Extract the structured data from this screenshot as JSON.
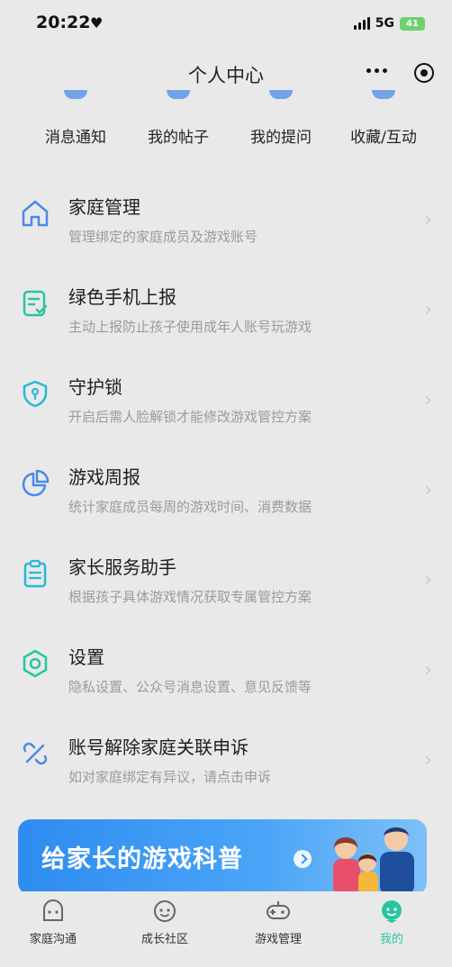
{
  "status": {
    "time": "20:22",
    "network": "5G",
    "battery": "41"
  },
  "header": {
    "title": "个人中心"
  },
  "quick_links": [
    {
      "label": "消息通知"
    },
    {
      "label": "我的帖子"
    },
    {
      "label": "我的提问"
    },
    {
      "label": "收藏/互动"
    }
  ],
  "menu": [
    {
      "title": "家庭管理",
      "desc": "管理绑定的家庭成员及游戏账号",
      "icon": "home-icon"
    },
    {
      "title": "绿色手机上报",
      "desc": "主动上报防止孩子使用成年人账号玩游戏",
      "icon": "report-doc-icon"
    },
    {
      "title": "守护锁",
      "desc": "开启后需人脸解锁才能修改游戏管控方案",
      "icon": "shield-lock-icon"
    },
    {
      "title": "游戏周报",
      "desc": "统计家庭成员每周的游戏时间、消费数据",
      "icon": "pie-chart-icon"
    },
    {
      "title": "家长服务助手",
      "desc": "根据孩子具体游戏情况获取专属管控方案",
      "icon": "clipboard-icon"
    },
    {
      "title": "设置",
      "desc": "隐私设置、公众号消息设置、意见反馈等",
      "icon": "settings-hexagon-icon"
    },
    {
      "title": "账号解除家庭关联申诉",
      "desc": "如对家庭绑定有异议，请点击申诉",
      "icon": "unlink-icon"
    }
  ],
  "banner": {
    "text": "给家长的游戏科普"
  },
  "tabs": [
    {
      "label": "家庭沟通",
      "icon": "chat-face-icon",
      "active": false
    },
    {
      "label": "成长社区",
      "icon": "community-face-icon",
      "active": false
    },
    {
      "label": "游戏管理",
      "icon": "gamepad-icon",
      "active": false
    },
    {
      "label": "我的",
      "icon": "profile-icon",
      "active": true
    }
  ],
  "colors": {
    "accent": "#27c6a0",
    "icon_blue": "#4a8ae6",
    "banner_blue": "#2e8cf0"
  }
}
